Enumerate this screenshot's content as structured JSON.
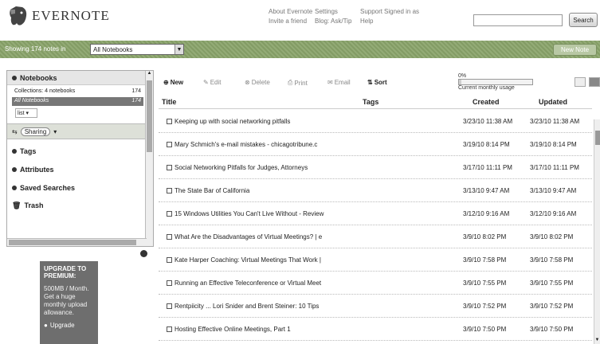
{
  "header": {
    "logo_text": "EVERNOTE",
    "links": [
      "About Evernote",
      "Settings",
      "Support",
      "Invite a friend",
      "Blog: Ask/Tip",
      "Help"
    ],
    "signed_in": "Signed in as",
    "search_placeholder": "",
    "search_button": "Search"
  },
  "toolbar": {
    "showing_label": "Showing 174 notes in",
    "notebook_select": "All Notebooks",
    "new_note_label": "New Note"
  },
  "sidebar": {
    "notebooks_label": "Notebooks",
    "notebooks": [
      {
        "name": "Collections: 4 notebooks",
        "count": "174"
      },
      {
        "name": "All Notebooks",
        "count": "174"
      }
    ],
    "sort_label": "list",
    "sharing_label": "Sharing",
    "sections": [
      "Tags",
      "Attributes",
      "Saved Searches",
      "Trash"
    ]
  },
  "upgrade": {
    "title": "UPGRADE TO PREMIUM:",
    "body": "500MB / Month. Get a huge monthly upload allowance.",
    "button": "Upgrade"
  },
  "notes_toolbar": {
    "new": "New",
    "edit": "Edit",
    "delete": "Delete",
    "print": "Print",
    "email": "Email",
    "sort": "Sort",
    "usage_label": "Current monthly usage",
    "usage_value": "0%",
    "usage_fraction": 0.03
  },
  "table": {
    "headers": {
      "title": "Title",
      "tags": "Tags",
      "created": "Created",
      "updated": "Updated"
    },
    "rows": [
      {
        "title": "Keeping up with social networking pitfalls",
        "created": "3/23/10 11:38 AM",
        "updated": "3/23/10 11:38 AM"
      },
      {
        "title": "Mary Schmich's e-mail mistakes - chicagotribune.c",
        "created": "3/19/10 8:14 PM",
        "updated": "3/19/10 8:14 PM"
      },
      {
        "title": "Social Networking Pitfalls for Judges, Attorneys",
        "created": "3/17/10 11:11 PM",
        "updated": "3/17/10 11:11 PM"
      },
      {
        "title": "The State Bar of California",
        "created": "3/13/10 9:47 AM",
        "updated": "3/13/10 9:47 AM"
      },
      {
        "title": "15 Windows Utilities You Can't Live Without - Review",
        "created": "3/12/10 9:16 AM",
        "updated": "3/12/10 9:16 AM"
      },
      {
        "title": "What Are the Disadvantages of Virtual Meetings? | e",
        "created": "3/9/10 8:02 PM",
        "updated": "3/9/10 8:02 PM"
      },
      {
        "title": "Kate Harper Coaching: Virtual Meetings That Work |",
        "created": "3/9/10 7:58 PM",
        "updated": "3/9/10 7:58 PM"
      },
      {
        "title": "Running an Effective Teleconference or Virtual Meet",
        "created": "3/9/10 7:55 PM",
        "updated": "3/9/10 7:55 PM"
      },
      {
        "title": "Rentpiicity ... Lori Snider and Brent Steiner: 10 Tips",
        "created": "3/9/10 7:52 PM",
        "updated": "3/9/10 7:52 PM"
      },
      {
        "title": "Hosting Effective Online Meetings, Part 1",
        "created": "3/9/10 7:50 PM",
        "updated": "3/9/10 7:50 PM"
      }
    ]
  },
  "colors": {
    "toolbar_green": "#8aa46a",
    "selected_row": "#777777",
    "upgrade_bg": "#6e6e6e"
  }
}
